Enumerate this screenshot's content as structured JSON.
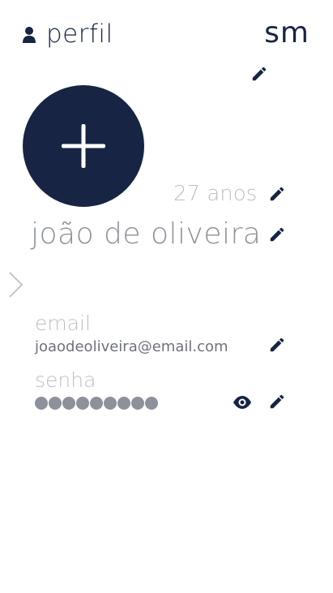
{
  "header": {
    "title": "perfil",
    "brand": "sm",
    "icon": "user-icon"
  },
  "profile": {
    "age": "27 anos",
    "name": "joão de oliveira"
  },
  "fields": {
    "email": {
      "label": "email",
      "value": "joaodeoliveira@email.com"
    },
    "password": {
      "label": "senha",
      "masked_length": 9
    }
  },
  "colors": {
    "primary": "#172444",
    "muted_label": "#bcc0c8",
    "text_gray": "#8d9199"
  }
}
